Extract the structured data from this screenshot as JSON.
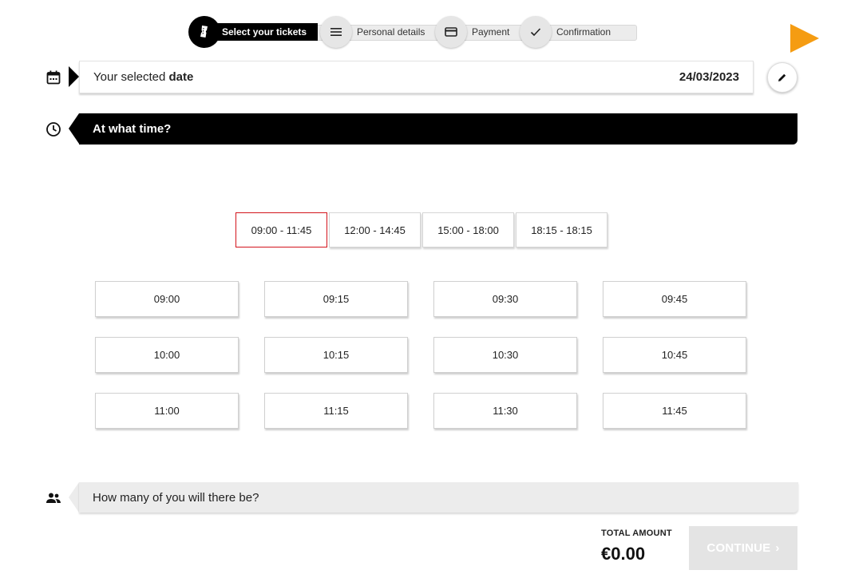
{
  "stepper": {
    "steps": [
      {
        "label": "Select your tickets",
        "icon": "ticket-icon",
        "active": true
      },
      {
        "label": "Personal details",
        "icon": "menu-icon",
        "active": false
      },
      {
        "label": "Payment",
        "icon": "credit-card-icon",
        "active": false
      },
      {
        "label": "Confirmation",
        "icon": "check-icon",
        "active": false
      }
    ]
  },
  "date_section": {
    "label_prefix": "Your selected ",
    "label_bold": "date",
    "value": "24/03/2023"
  },
  "time_section": {
    "title": "At what time?",
    "ranges": [
      "09:00 - 11:45",
      "12:00 - 14:45",
      "15:00 - 18:00",
      "18:15 - 18:15"
    ],
    "selected_range": "09:00 - 11:45",
    "slots": [
      "09:00",
      "09:15",
      "09:30",
      "09:45",
      "10:00",
      "10:15",
      "10:30",
      "10:45",
      "11:00",
      "11:15",
      "11:30",
      "11:45"
    ]
  },
  "people_section": {
    "title": "How many of you will there be?"
  },
  "footer": {
    "total_label": "TOTAL AMOUNT",
    "total_value": "€0.00",
    "continue_label": "CONTINUE",
    "continue_chevron": "›"
  },
  "colors": {
    "accent_orange": "#f59c12",
    "selected_border": "#d3141c",
    "header_black": "#000000",
    "disabled_grey": "#e4e4e4"
  }
}
